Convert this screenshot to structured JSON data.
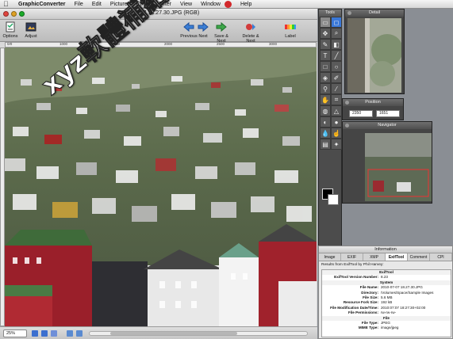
{
  "menubar": {
    "app": "GraphicConverter",
    "items": [
      "File",
      "Edit",
      "Picture",
      "Effect",
      "Filter",
      "View",
      "Window",
      "Help"
    ]
  },
  "window": {
    "title": "2010-07-07 18.27.30.JPG (RGB)"
  },
  "toolbar": {
    "options": "Options",
    "adjust": "Adjust",
    "previous": "Previous",
    "next": "Next",
    "save_next": "Save & Next",
    "delete_next": "Delete & Next",
    "label": "Label"
  },
  "ruler_ticks": [
    "0/0",
    "1000",
    "1500",
    "2000",
    "2500",
    "3000"
  ],
  "statusbar": {
    "zoom": "25%"
  },
  "palettes": {
    "tools_title": "Tools",
    "detail_title": "Detail",
    "position_title": "Position",
    "position_x": "2350",
    "position_y": "1651",
    "navigator_title": "Navigator"
  },
  "info": {
    "window_title": "Information",
    "tabs": [
      "Image",
      "EXIF",
      "XMP",
      "ExifTool",
      "Comment",
      "CPI"
    ],
    "active_tab": "ExifTool",
    "results_header": "Results from ExifTool by Phil Harvey:",
    "rows": [
      {
        "section": "ExifTool"
      },
      {
        "k": "ExifTool Version Number:",
        "v": "8.23"
      },
      {
        "section": "System"
      },
      {
        "k": "File Name:",
        "v": "2010-07-07 18.27.30.JPG"
      },
      {
        "k": "Directory:",
        "v": "/Volumes/Space/Sample Images"
      },
      {
        "k": "File Size:",
        "v": "5.6 MB"
      },
      {
        "k": "Resource Fork Size:",
        "v": "192 kB"
      },
      {
        "k": "File Modification Date/Time:",
        "v": "2010:07:07 18:27:30+02:00"
      },
      {
        "k": "File Permissions:",
        "v": "rw-rw-rw-"
      },
      {
        "section": "File"
      },
      {
        "k": "File Type:",
        "v": "JPEG"
      },
      {
        "k": "MIME Type:",
        "v": "image/jpeg"
      }
    ]
  },
  "watermark": "xyz軟體補給站 http://31.to",
  "colors": {
    "foreground_swatch": "#000000",
    "background_swatch": "#ffffff",
    "apple_menu_badge": "#d2282b"
  }
}
